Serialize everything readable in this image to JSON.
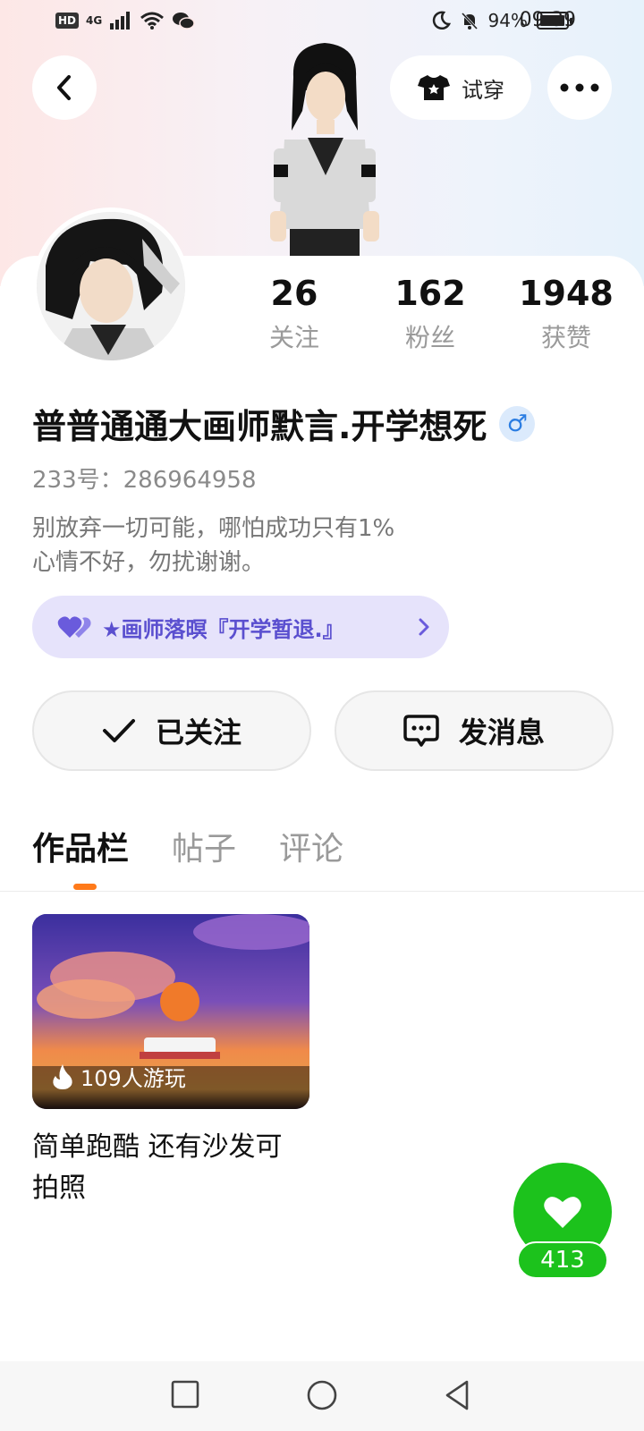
{
  "status_bar": {
    "network": "HD",
    "signal": "4G",
    "battery_pct": "94%",
    "time": "09:39",
    "icons": [
      "hd-icon",
      "signal-icon",
      "wifi-icon",
      "wechat-icon",
      "moon-icon",
      "bell-off-icon",
      "battery-icon"
    ]
  },
  "header": {
    "try_on_label": "试穿"
  },
  "profile": {
    "stats": [
      {
        "value": "26",
        "label": "关注"
      },
      {
        "value": "162",
        "label": "粉丝"
      },
      {
        "value": "1948",
        "label": "获赞"
      }
    ],
    "name": "普普通通大画师默言.开学想死",
    "gender_symbol": "♂",
    "id_line": "233号：286964958",
    "bio_line1": "别放弃一切可能，哪怕成功只有1%",
    "bio_line2": "心情不好，勿扰谢谢。",
    "group_label": "★画师落暝『开学暂退.』"
  },
  "actions": {
    "follow_label": "已关注",
    "message_label": "发消息"
  },
  "tabs": [
    {
      "label": "作品栏",
      "active": true
    },
    {
      "label": "帖子",
      "active": false
    },
    {
      "label": "评论",
      "active": false
    }
  ],
  "works": [
    {
      "players": "109人游玩",
      "title": "简单跑酷 还有沙发可拍照"
    }
  ],
  "like": {
    "count": "413"
  },
  "colors": {
    "accent_orange": "#ff7a1a",
    "like_green": "#1cc21c",
    "chip_purple": "#5a4fcf"
  }
}
